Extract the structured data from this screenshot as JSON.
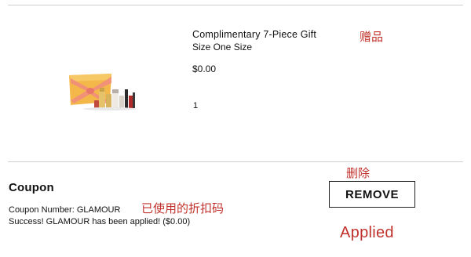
{
  "product": {
    "title": "Complimentary 7-Piece Gift",
    "size": "Size One Size",
    "price": "$0.00",
    "quantity": "1",
    "image_icon": "cosmetic-gift-set-image"
  },
  "coupon": {
    "heading": "Coupon",
    "number_line": "Coupon Number: GLAMOUR",
    "status_line": "Success! GLAMOUR has been applied! ($0.00)",
    "remove_label": "REMOVE"
  },
  "annotations": {
    "gift": "赠品",
    "delete": "删除",
    "used_code": "已使用的折扣码",
    "applied": "Applied",
    "color": "#c0312b"
  }
}
